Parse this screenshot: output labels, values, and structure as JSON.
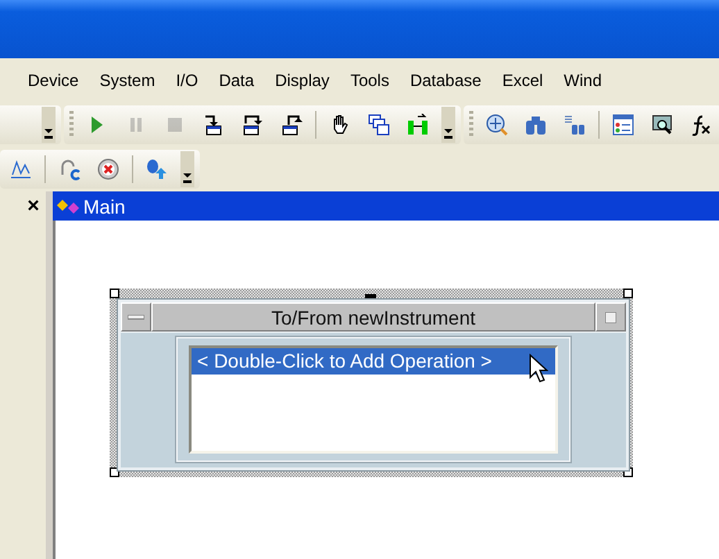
{
  "menu": [
    "Device",
    "System",
    "I/O",
    "Data",
    "Display",
    "Tools",
    "Database",
    "Excel",
    "Wind"
  ],
  "toolbar_1": [
    {
      "kind": "run",
      "disabled": false
    },
    {
      "kind": "pause",
      "disabled": true
    },
    {
      "kind": "stop",
      "disabled": true
    },
    {
      "kind": "step-into",
      "disabled": false
    },
    {
      "kind": "step-over",
      "disabled": false
    },
    {
      "kind": "step-out",
      "disabled": false
    },
    {
      "kind": "sep"
    },
    {
      "kind": "hand",
      "disabled": false
    },
    {
      "kind": "windows",
      "disabled": false
    },
    {
      "kind": "connector",
      "disabled": false
    }
  ],
  "toolbar_2": [
    {
      "kind": "zoom"
    },
    {
      "kind": "binoculars"
    },
    {
      "kind": "binoculars-list"
    },
    {
      "kind": "sep"
    },
    {
      "kind": "properties"
    },
    {
      "kind": "monitor-search"
    },
    {
      "kind": "fx"
    }
  ],
  "toolbar_3": [
    {
      "kind": "sep"
    },
    {
      "kind": "curl-c"
    },
    {
      "kind": "stop-x"
    },
    {
      "kind": "sep"
    },
    {
      "kind": "blob-up"
    }
  ],
  "panel": {
    "close": "×"
  },
  "document": {
    "title": "Main"
  },
  "object": {
    "title": "To/From newInstrument",
    "items": [
      {
        "label": "< Double-Click to Add Operation >",
        "selected": true
      }
    ]
  }
}
